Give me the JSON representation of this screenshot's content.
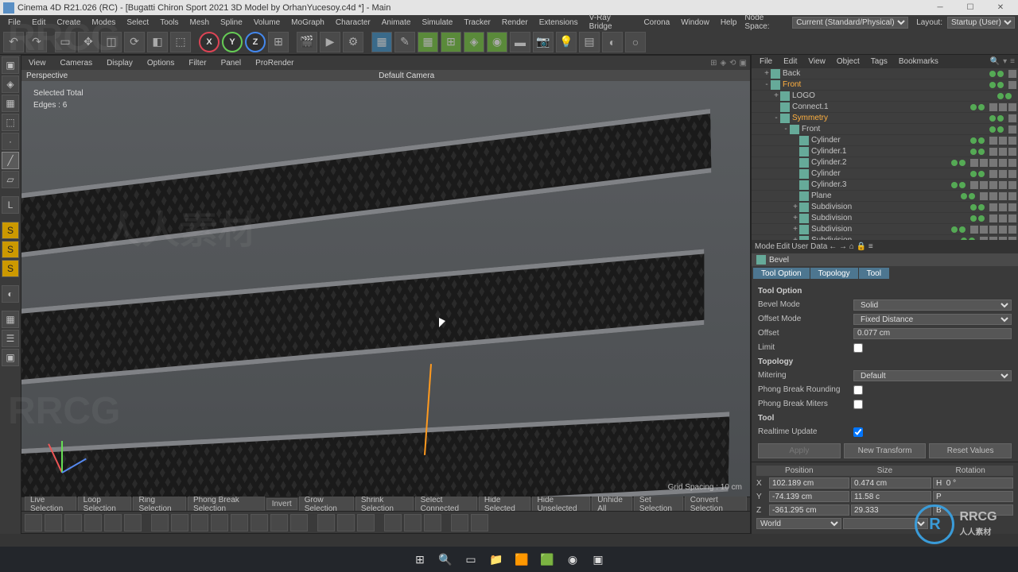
{
  "title": "Cinema 4D R21.026 (RC) - [Bugatti Chiron Sport 2021 3D Model by OrhanYucesoy.c4d *] - Main",
  "menubar": [
    "File",
    "Edit",
    "Create",
    "Modes",
    "Select",
    "Tools",
    "Mesh",
    "Spline",
    "Volume",
    "MoGraph",
    "Character",
    "Animate",
    "Simulate",
    "Tracker",
    "Render",
    "Extensions",
    "V-Ray Bridge",
    "Corona",
    "Window",
    "Help"
  ],
  "rightMenu": {
    "node_space_label": "Node Space:",
    "node_space_value": "Current (Standard/Physical)",
    "layout_label": "Layout:",
    "layout_value": "Startup (User)"
  },
  "vpmenu": [
    "View",
    "Cameras",
    "Display",
    "Options",
    "Filter",
    "Panel",
    "ProRender"
  ],
  "vpheader": {
    "mode": "Perspective",
    "camera": "Default Camera"
  },
  "hud": {
    "selected": "Selected Total",
    "edges": "Edges : 6",
    "grid": "Grid Spacing : 10 cm"
  },
  "selbar": [
    "Live Selection",
    "Loop Selection",
    "Ring Selection",
    "Phong Break Selection",
    "Invert",
    "Grow Selection",
    "Shrink Selection",
    "Select Connected",
    "Hide Selected",
    "Hide Unselected",
    "Unhide All",
    "Set Selection",
    "Convert Selection"
  ],
  "objTabs": [
    "File",
    "Edit",
    "View",
    "Object",
    "Tags",
    "Bookmarks"
  ],
  "objects": [
    {
      "indent": 1,
      "name": "Back",
      "exp": "+",
      "sel": false,
      "tags": 1
    },
    {
      "indent": 1,
      "name": "Front",
      "exp": "-",
      "sel": true,
      "tags": 1
    },
    {
      "indent": 2,
      "name": "LOGO",
      "exp": "+",
      "sel": false,
      "tags": 0
    },
    {
      "indent": 2,
      "name": "Connect.1",
      "exp": "",
      "sel": false,
      "tags": 3
    },
    {
      "indent": 2,
      "name": "Symmetry",
      "exp": "-",
      "sel": true,
      "tags": 1
    },
    {
      "indent": 3,
      "name": "Front",
      "exp": "-",
      "sel": false,
      "tags": 1
    },
    {
      "indent": 4,
      "name": "Cylinder",
      "exp": "",
      "sel": false,
      "tags": 3
    },
    {
      "indent": 4,
      "name": "Cylinder.1",
      "exp": "",
      "sel": false,
      "tags": 3
    },
    {
      "indent": 4,
      "name": "Cylinder.2",
      "exp": "",
      "sel": false,
      "tags": 5
    },
    {
      "indent": 4,
      "name": "Cylinder",
      "exp": "",
      "sel": false,
      "tags": 3
    },
    {
      "indent": 4,
      "name": "Cylinder.3",
      "exp": "",
      "sel": false,
      "tags": 5
    },
    {
      "indent": 4,
      "name": "Plane",
      "exp": "",
      "sel": false,
      "tags": 4
    },
    {
      "indent": 4,
      "name": "Subdivision",
      "exp": "+",
      "sel": false,
      "tags": 3
    },
    {
      "indent": 4,
      "name": "Subdivision",
      "exp": "+",
      "sel": false,
      "tags": 3
    },
    {
      "indent": 4,
      "name": "Subdivision",
      "exp": "+",
      "sel": false,
      "tags": 5
    },
    {
      "indent": 4,
      "name": "Subdivision",
      "exp": "+",
      "sel": false,
      "tags": 4
    }
  ],
  "attrTabs": [
    "Mode",
    "Edit",
    "User Data"
  ],
  "toolName": "Bevel",
  "subtabs": [
    "Tool Option",
    "Topology",
    "Tool"
  ],
  "toolOption": {
    "header": "Tool Option",
    "bevel_mode_label": "Bevel Mode",
    "bevel_mode": "Solid",
    "offset_mode_label": "Offset Mode",
    "offset_mode": "Fixed Distance",
    "offset_label": "Offset",
    "offset": "0.077 cm",
    "limit_label": "Limit"
  },
  "topology": {
    "header": "Topology",
    "mitering_label": "Mitering",
    "mitering": "Default",
    "pbr_label": "Phong Break Rounding",
    "pbm_label": "Phong Break Miters"
  },
  "tool": {
    "header": "Tool",
    "realtime_label": "Realtime Update",
    "apply": "Apply",
    "newt": "New Transform",
    "reset": "Reset Values"
  },
  "coords": {
    "headers": [
      "Position",
      "Size",
      "Rotation"
    ],
    "rows": [
      {
        "l": "X",
        "p": "102.189 cm",
        "s": "0.474 cm",
        "r": "H  0 °"
      },
      {
        "l": "Y",
        "p": "-74.139 cm",
        "s": "11.58 c",
        "r": "P"
      },
      {
        "l": "Z",
        "p": "-361.295 cm",
        "s": "29.333",
        "r": "B"
      }
    ],
    "frame": "World"
  },
  "watermark": "人人素材 RRCG"
}
